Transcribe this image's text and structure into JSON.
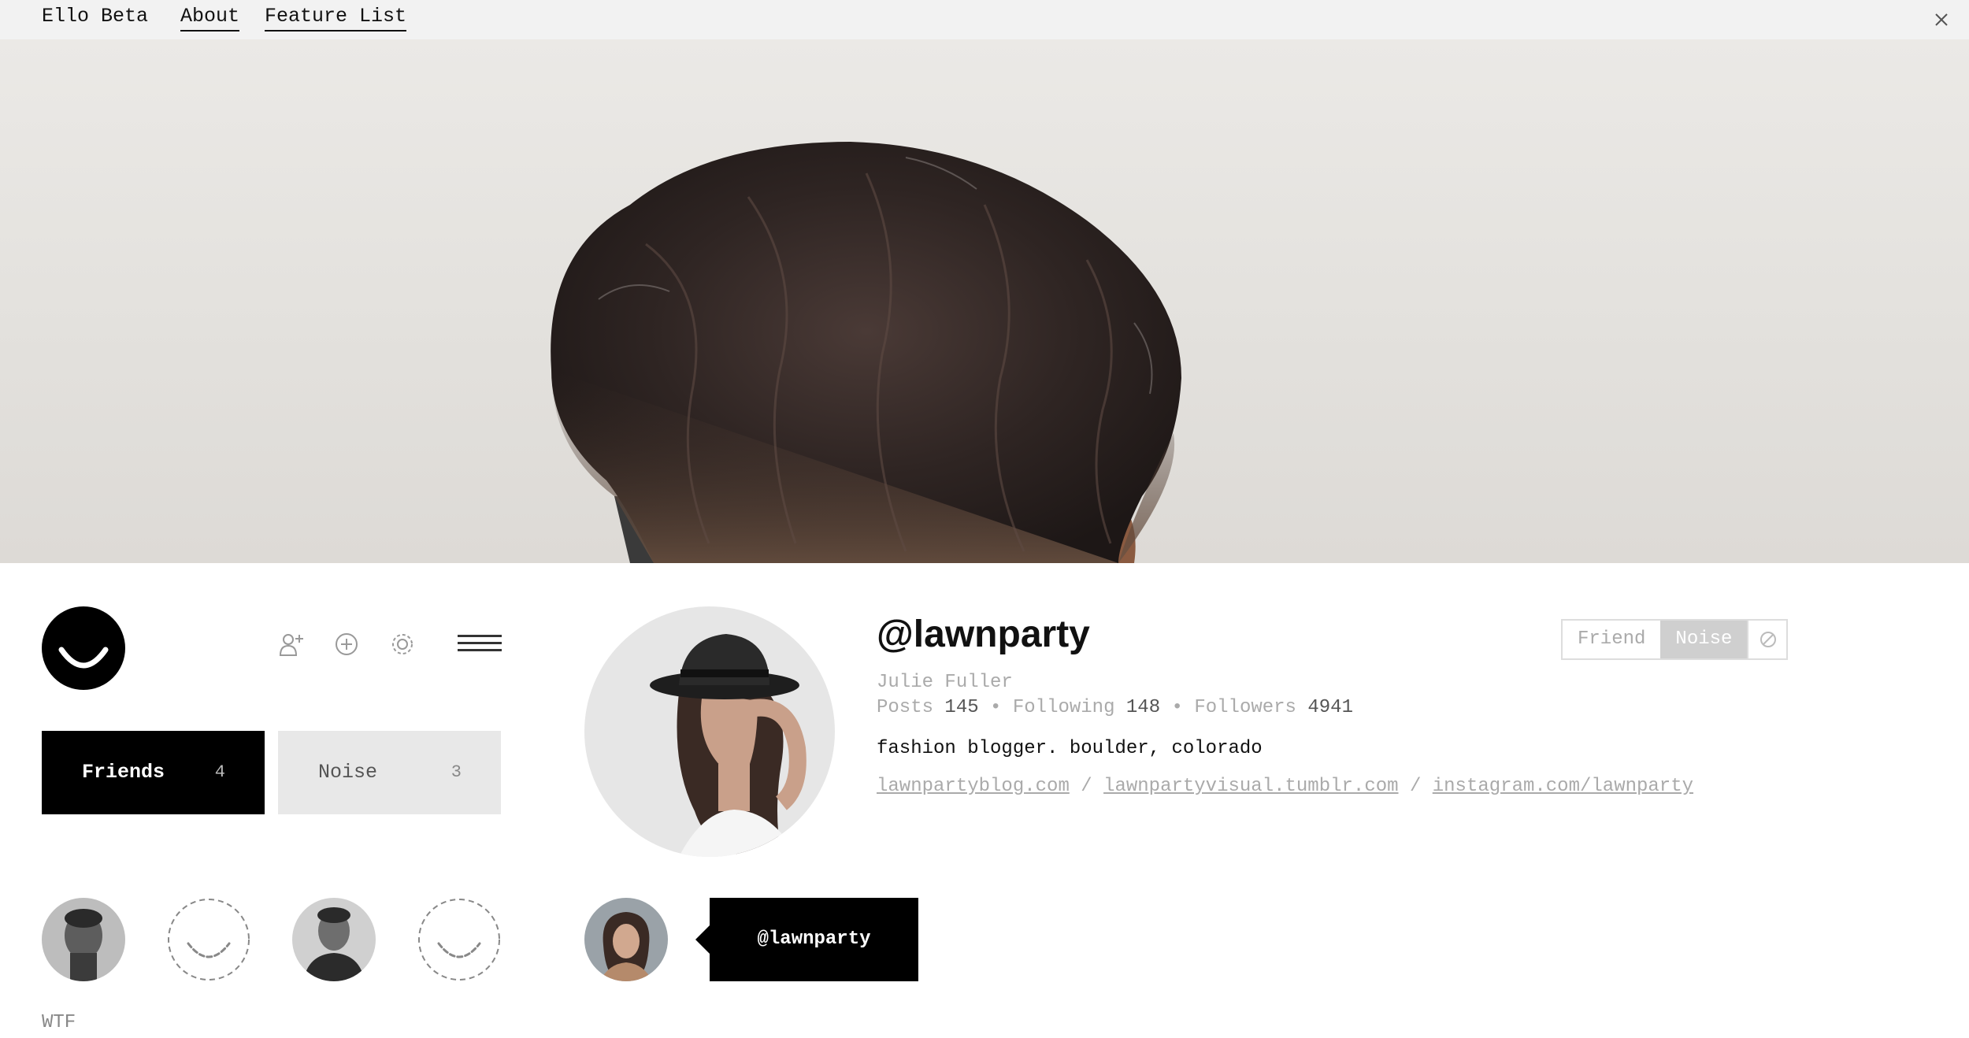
{
  "topbar": {
    "brand": "Ello Beta",
    "nav": [
      {
        "label": "About"
      },
      {
        "label": "Feature List"
      }
    ],
    "close_icon": "close-icon"
  },
  "cover": {
    "icon": "cover-photo"
  },
  "sidebar": {
    "logo_icon": "ello-smile-logo",
    "tools": [
      {
        "icon": "add-friend-icon"
      },
      {
        "icon": "add-post-icon"
      },
      {
        "icon": "gear-icon"
      },
      {
        "icon": "menu-icon"
      }
    ],
    "streams": [
      {
        "label": "Friends",
        "count": "4",
        "active": true
      },
      {
        "label": "Noise",
        "count": "3",
        "active": false
      }
    ],
    "avatars": [
      {
        "icon": "user-avatar-photo"
      },
      {
        "icon": "default-smile-avatar"
      },
      {
        "icon": "user-avatar-photo"
      },
      {
        "icon": "default-smile-avatar"
      }
    ],
    "wtf_label": "WTF"
  },
  "profile": {
    "username": "@lawnparty",
    "full_name": "Julie Fuller",
    "stats": {
      "posts_label": "Posts",
      "posts": "145",
      "following_label": "Following",
      "following": "148",
      "followers_label": "Followers",
      "followers": "4941",
      "separator": "•"
    },
    "bio": "fashion blogger. boulder, colorado",
    "links": [
      "lawnpartyblog.com",
      "lawnpartyvisual.tumblr.com",
      "instagram.com/lawnparty"
    ],
    "link_separator": "/",
    "relationship": {
      "friend_label": "Friend",
      "noise_label": "Noise",
      "block_icon": "block-icon",
      "selected": "Noise"
    }
  },
  "composer": {
    "mention": "@lawnparty"
  },
  "colors": {
    "black": "#000000",
    "topbar_bg": "#f2f2f2",
    "muted_text": "#aaaaaa",
    "noise_bg": "#e8e8e8",
    "noise_selected": "#cfcfcf"
  }
}
